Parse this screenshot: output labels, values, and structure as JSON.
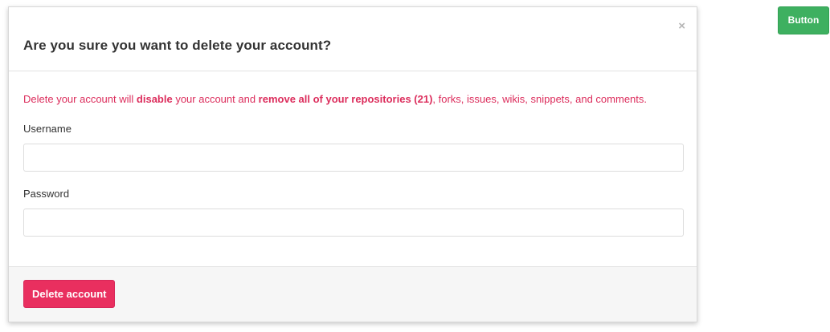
{
  "page": {
    "open_button_label": "Button"
  },
  "modal": {
    "title": "Are you sure you want to delete your account?",
    "close_glyph": "×",
    "close_icon": "close-icon",
    "warning": {
      "part1": "Delete your account will ",
      "bold1": "disable",
      "part2": " your account and ",
      "bold2": "remove all of your repositories (21)",
      "part3": ", forks, issues, wikis, snippets, and comments."
    },
    "fields": {
      "username_label": "Username",
      "username_value": "",
      "password_label": "Password",
      "password_value": ""
    },
    "footer": {
      "delete_label": "Delete account"
    }
  },
  "colors": {
    "danger": "#e92f5f",
    "warning_text": "#dc2d5c",
    "success": "#3eb060",
    "footer_bg": "#f6f6f6"
  }
}
